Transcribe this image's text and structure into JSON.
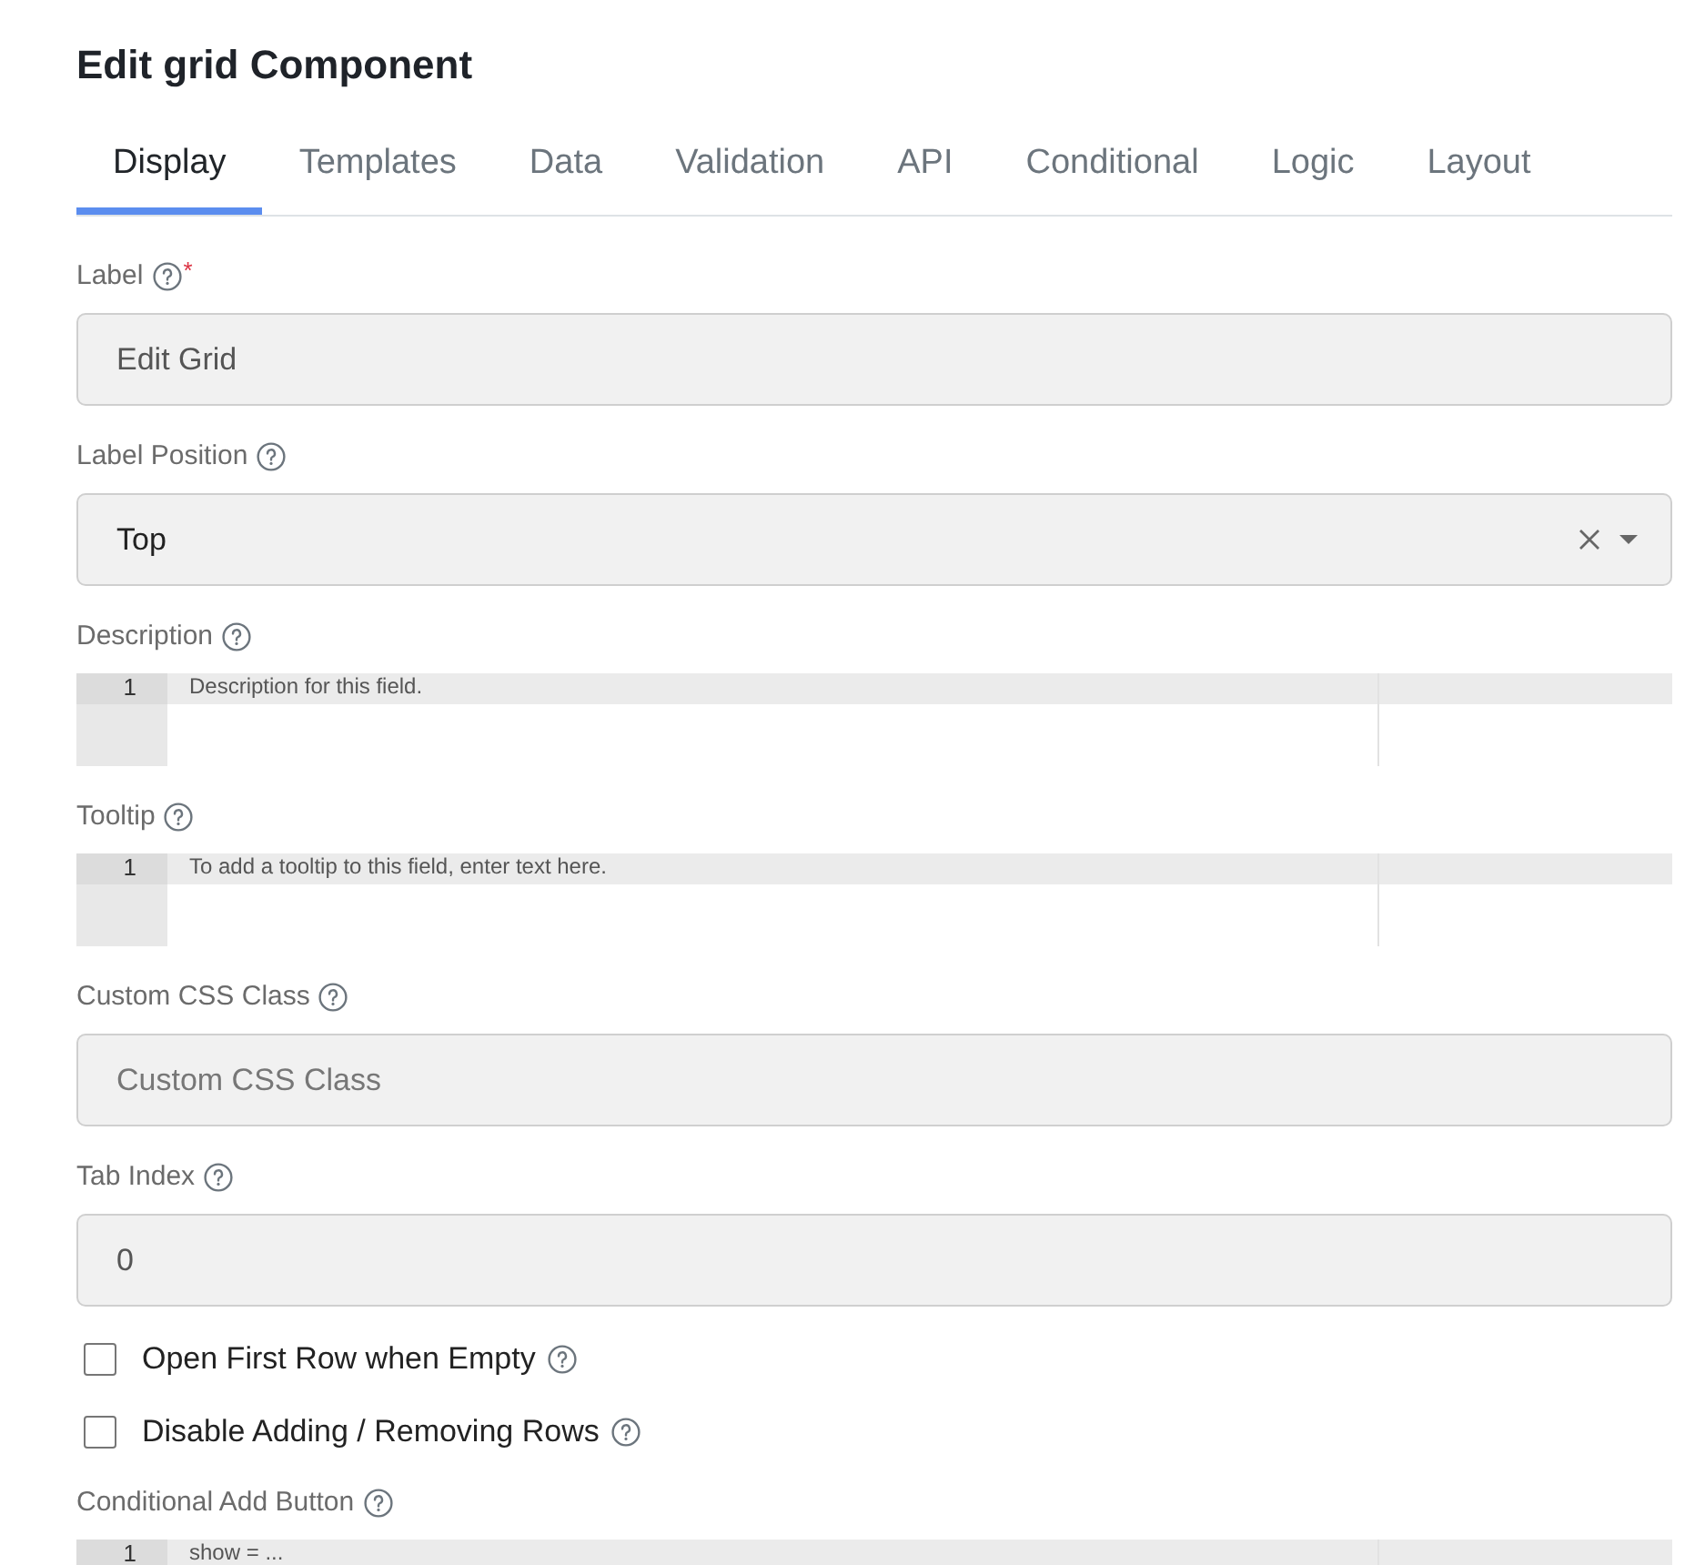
{
  "title": "Edit grid Component",
  "tabs": [
    {
      "label": "Display",
      "selected": true
    },
    {
      "label": "Templates",
      "selected": false
    },
    {
      "label": "Data",
      "selected": false
    },
    {
      "label": "Validation",
      "selected": false
    },
    {
      "label": "API",
      "selected": false
    },
    {
      "label": "Conditional",
      "selected": false
    },
    {
      "label": "Logic",
      "selected": false
    },
    {
      "label": "Layout",
      "selected": false
    }
  ],
  "fields": [
    {
      "kind": "text",
      "label": "Label",
      "required_mark": "*",
      "value": "Edit Grid"
    },
    {
      "kind": "select",
      "label": "Label Position",
      "value": "Top"
    },
    {
      "kind": "code",
      "label": "Description",
      "line_number": "1",
      "placeholder": "Description for this field."
    },
    {
      "kind": "code",
      "label": "Tooltip",
      "line_number": "1",
      "placeholder": "To add a tooltip to this field, enter text here."
    },
    {
      "kind": "text",
      "label": "Custom CSS Class",
      "placeholder": "Custom CSS Class"
    },
    {
      "kind": "text",
      "label": "Tab Index",
      "value": "0"
    },
    {
      "kind": "checkbox",
      "label": "Open First Row when Empty",
      "checked": false
    },
    {
      "kind": "checkbox",
      "label": "Disable Adding / Removing Rows",
      "checked": false
    },
    {
      "kind": "code",
      "label": "Conditional Add Button",
      "line_number": "1",
      "placeholder": "show = ..."
    }
  ]
}
